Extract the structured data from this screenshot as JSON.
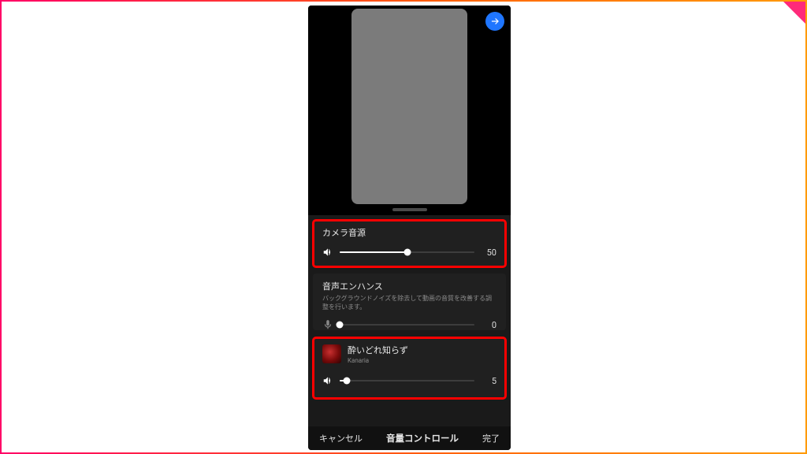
{
  "sliders": {
    "camera": {
      "title": "カメラ音源",
      "value": 50,
      "max": 100
    },
    "enhance": {
      "title": "音声エンハンス",
      "desc": "バックグラウンドノイズを除去して動画の音質を改善する調整を行います。",
      "value": 0,
      "max": 100
    },
    "music": {
      "title": "酔いどれ知らず",
      "artist": "Kanaria",
      "value": 5,
      "max": 100
    }
  },
  "toolbar": {
    "cancel": "キャンセル",
    "title": "音量コントロール",
    "done": "完了"
  }
}
